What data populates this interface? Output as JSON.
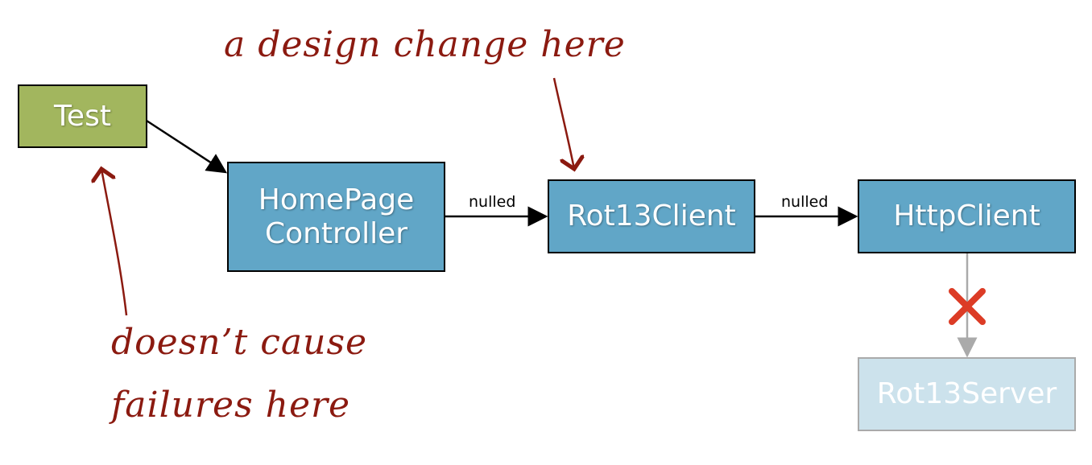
{
  "nodes": {
    "test": "Test",
    "homepage_controller": [
      "HomePage",
      "Controller"
    ],
    "rot13_client": "Rot13Client",
    "http_client": "HttpClient",
    "rot13_server": "Rot13Server"
  },
  "edges": {
    "homepage_to_rot13client": "nulled",
    "rot13client_to_httpclient": "nulled"
  },
  "annotations": {
    "design_change": "a design change here",
    "no_failures_line1": "doesn’t cause",
    "no_failures_line2": "failures here"
  },
  "colors": {
    "test_box": "#a2b65e",
    "component_box": "#61a6c7",
    "disabled_box": "#cce2ec",
    "annotation": "#8b1a10",
    "blocked_x": "#dc3c26"
  },
  "icons": {
    "blocked": "red-x-icon"
  }
}
